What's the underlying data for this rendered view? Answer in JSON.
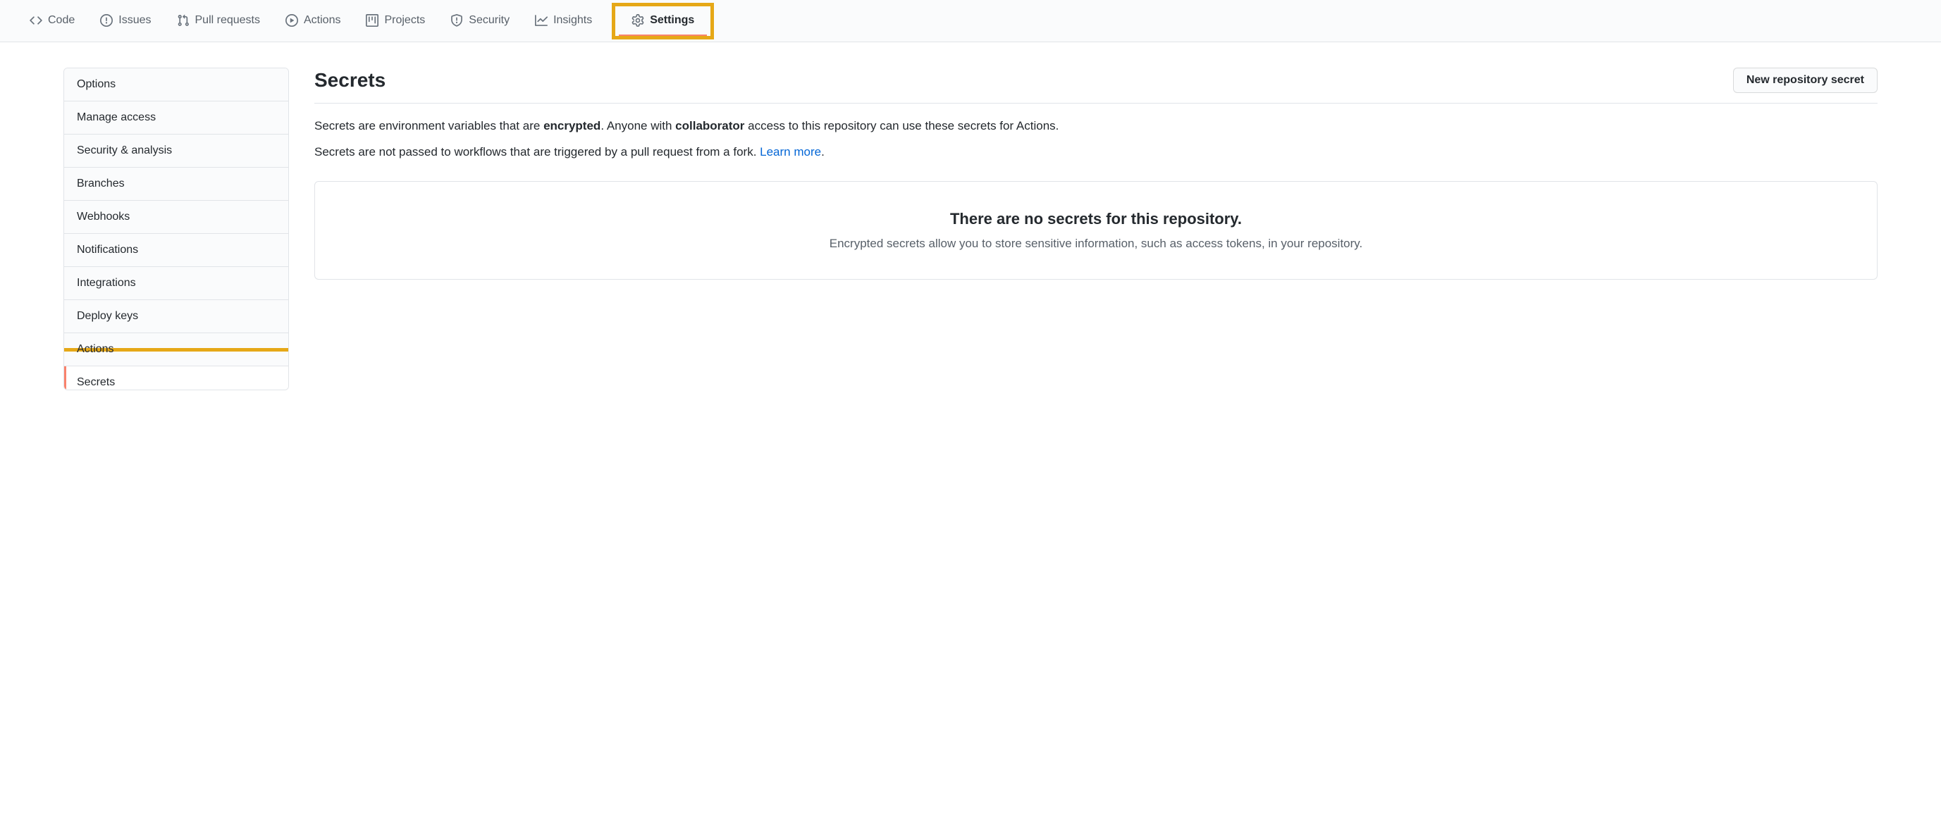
{
  "nav": {
    "tabs": [
      {
        "label": "Code",
        "icon": "code-icon"
      },
      {
        "label": "Issues",
        "icon": "issues-icon"
      },
      {
        "label": "Pull requests",
        "icon": "pull-request-icon"
      },
      {
        "label": "Actions",
        "icon": "play-icon"
      },
      {
        "label": "Projects",
        "icon": "project-icon"
      },
      {
        "label": "Security",
        "icon": "shield-icon"
      },
      {
        "label": "Insights",
        "icon": "graph-icon"
      },
      {
        "label": "Settings",
        "icon": "gear-icon"
      }
    ]
  },
  "sidebar": {
    "items": [
      {
        "label": "Options"
      },
      {
        "label": "Manage access"
      },
      {
        "label": "Security & analysis"
      },
      {
        "label": "Branches"
      },
      {
        "label": "Webhooks"
      },
      {
        "label": "Notifications"
      },
      {
        "label": "Integrations"
      },
      {
        "label": "Deploy keys"
      },
      {
        "label": "Actions"
      },
      {
        "label": "Secrets"
      }
    ]
  },
  "content": {
    "title": "Secrets",
    "new_button": "New repository secret",
    "desc_pre": "Secrets are environment variables that are ",
    "desc_bold1": "encrypted",
    "desc_mid": ". Anyone with ",
    "desc_bold2": "collaborator",
    "desc_post": " access to this repository can use these secrets for Actions.",
    "desc2_pre": "Secrets are not passed to workflows that are triggered by a pull request from a fork. ",
    "desc2_link": "Learn more",
    "desc2_post": ".",
    "empty_title": "There are no secrets for this repository.",
    "empty_subtitle": "Encrypted secrets allow you to store sensitive information, such as access tokens, in your repository."
  }
}
